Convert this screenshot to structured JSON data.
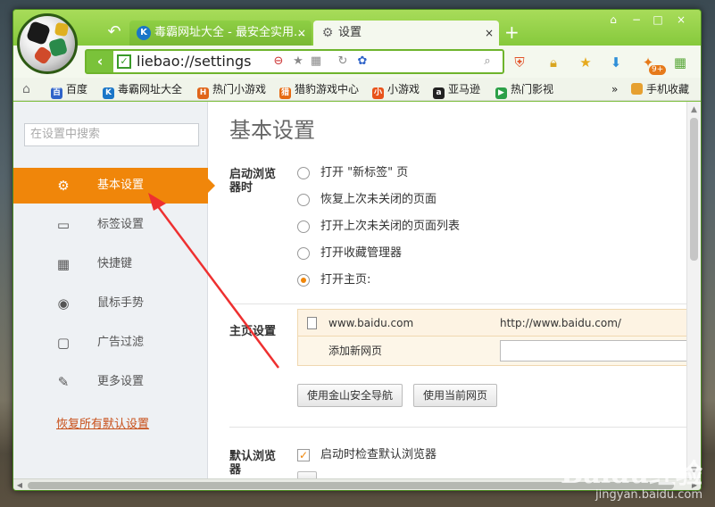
{
  "browser": {
    "tabs": [
      {
        "icon": "K",
        "label": "毒霸网址大全 - 最安全实用...",
        "close": "×"
      },
      {
        "icon": "⚙",
        "label": "设置",
        "close": "×"
      }
    ],
    "new_tab": "+",
    "window_controls": [
      "⌂",
      "−",
      "□",
      "×"
    ],
    "back_arrow": "↶",
    "address_url": "liebao://settings",
    "bookmarks": [
      {
        "icon": "百",
        "label": "百度",
        "color": "#2f63c9"
      },
      {
        "icon": "K",
        "label": "毒霸网址大全",
        "color": "#1a76c8"
      },
      {
        "icon": "H",
        "label": "热门小游戏",
        "color": "#e0651a"
      },
      {
        "icon": "猎",
        "label": "猎豹游戏中心",
        "color": "#e66a12"
      },
      {
        "icon": "小",
        "label": "小游戏",
        "color": "#e8531a"
      },
      {
        "icon": "a",
        "label": "亚马逊",
        "color": "#222222"
      },
      {
        "icon": "▶",
        "label": "热门影视",
        "color": "#2ca048"
      }
    ],
    "bookmarks_more": "»",
    "mobile_favorites": "手机收藏",
    "game_badge": "9+"
  },
  "sidebar": {
    "search_placeholder": "在设置中搜索",
    "items": [
      {
        "icon": "⚙",
        "label": "基本设置"
      },
      {
        "icon": "▭",
        "label": "标签设置"
      },
      {
        "icon": "▦",
        "label": "快捷键"
      },
      {
        "icon": "◉",
        "label": "鼠标手势"
      },
      {
        "icon": "▢",
        "label": "广告过滤"
      },
      {
        "icon": "✎",
        "label": "更多设置"
      }
    ],
    "restore": "恢复所有默认设置"
  },
  "main": {
    "title": "基本设置",
    "startup": {
      "label_line1": "启动浏览",
      "label_line2": "器时",
      "options": [
        "打开 \"新标签\" 页",
        "恢复上次未关闭的页面",
        "打开上次未关闭的页面列表",
        "打开收藏管理器",
        "打开主页:"
      ],
      "selected_index": 4
    },
    "homepage": {
      "label": "主页设置",
      "entry_name": "www.baidu.com",
      "entry_url": "http://www.baidu.com/",
      "add_label": "添加新网页",
      "button_1": "使用金山安全导航",
      "button_2": "使用当前网页"
    },
    "default_browser": {
      "label_line1": "默认浏览",
      "label_line2": "器",
      "check_label": "启动时检查默认浏览器",
      "checked": true
    }
  },
  "accent_color": "#f0860a",
  "watermark": {
    "logo": "Baidu经验",
    "sub": "jingyan.baidu.com"
  }
}
